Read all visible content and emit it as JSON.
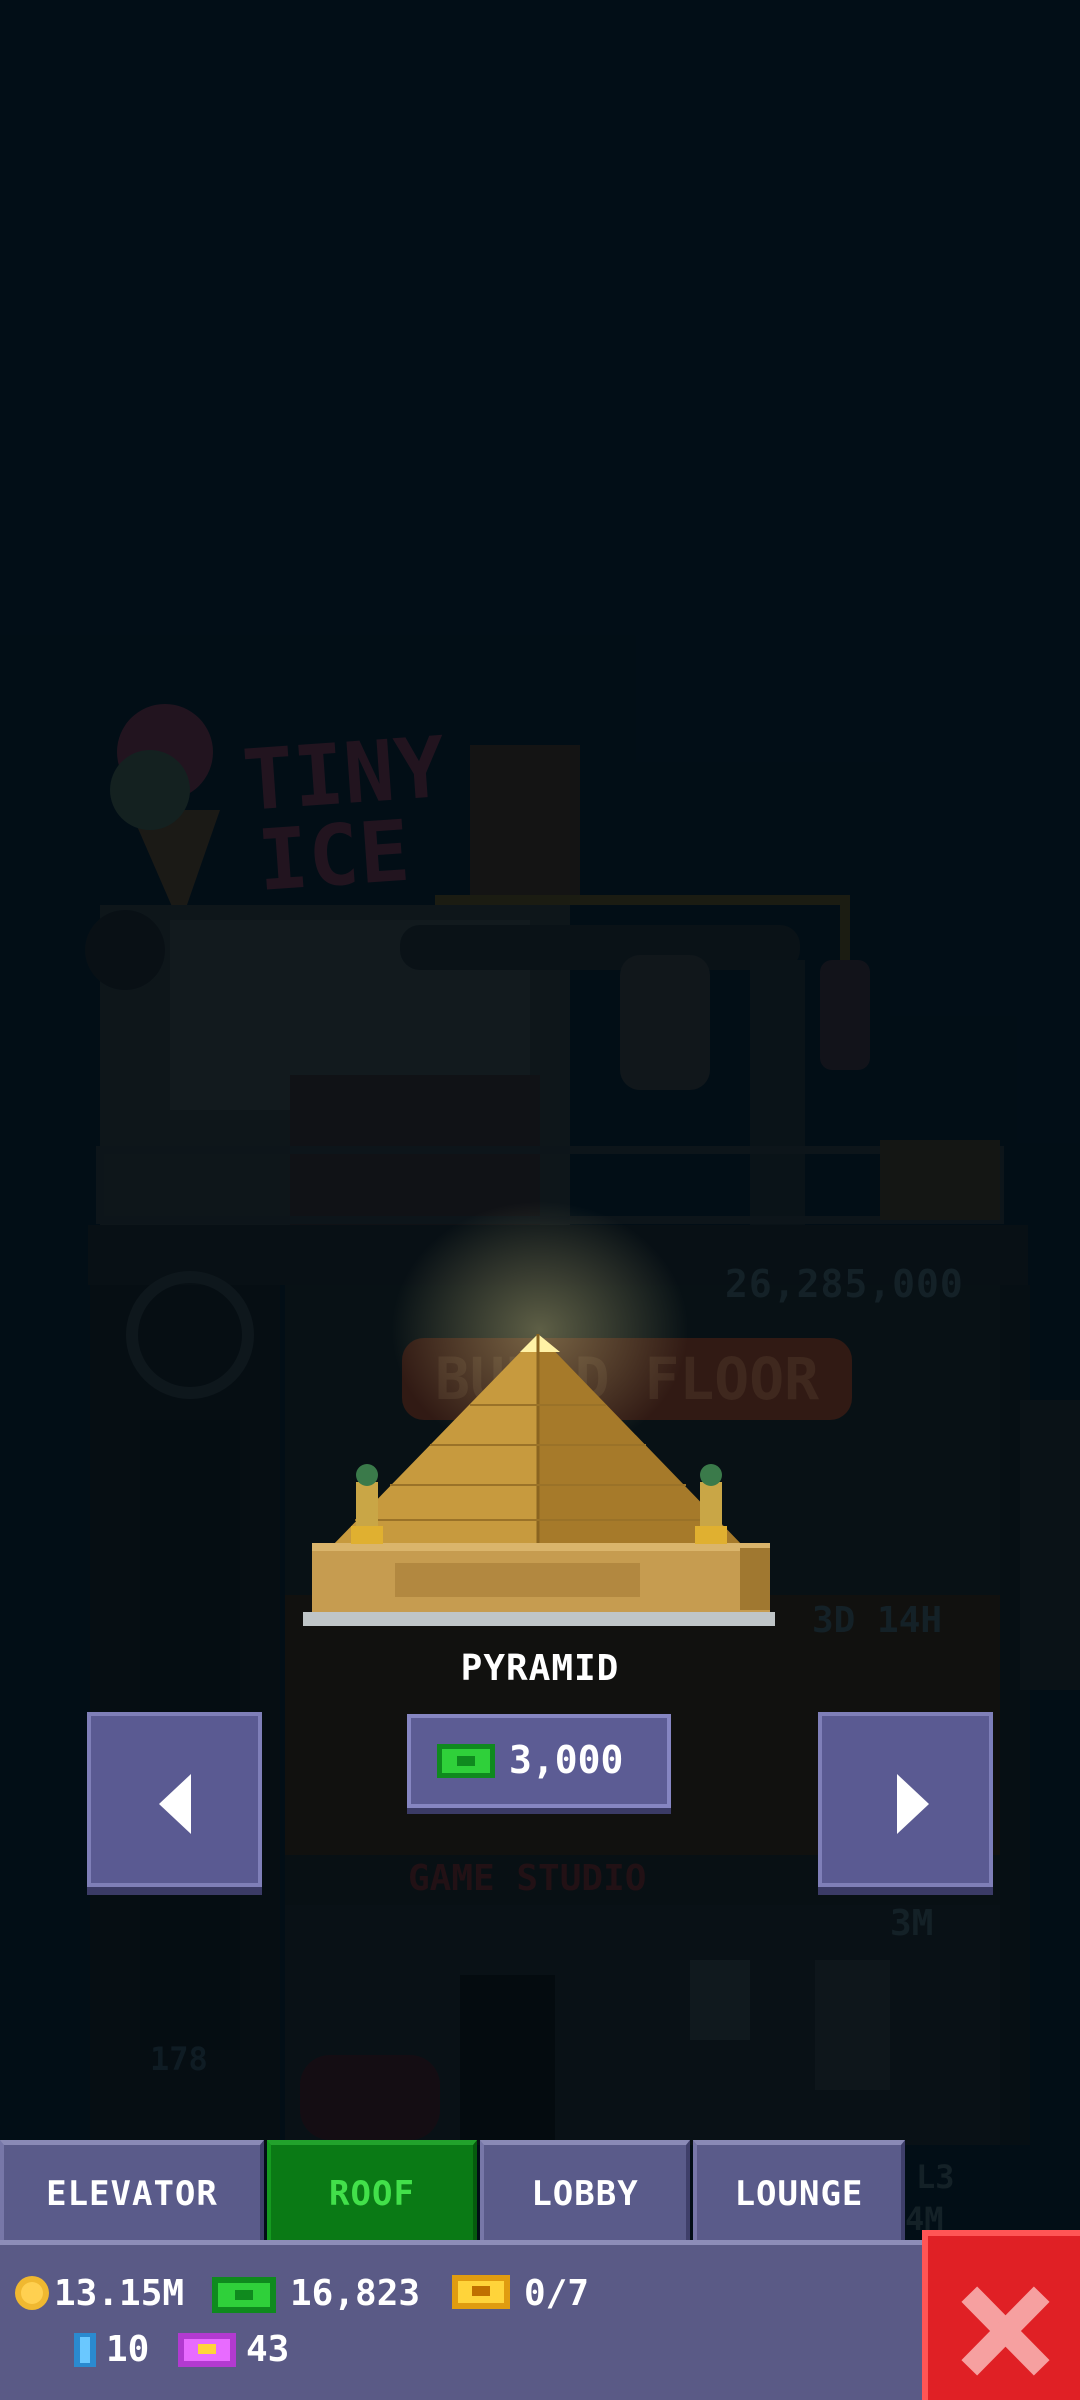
{
  "background": {
    "floor_price": "26,285,000",
    "build_floor_label": "BUILD FLOOR",
    "timer": "3D 14H",
    "studio_name": "GAME STUDIO",
    "studio_price": "3M",
    "floor_number": "178",
    "side_level": "L3",
    "side_value": "4M",
    "sign_text": "TINY ICE"
  },
  "preview": {
    "item_name": "PYRAMID",
    "price": "3,000",
    "price_icon": "bux-icon"
  },
  "nav": {
    "prev_icon": "left-arrow-icon",
    "next_icon": "right-arrow-icon"
  },
  "tabs": [
    {
      "label": "ELEVATOR",
      "active": false
    },
    {
      "label": "ROOF",
      "active": true
    },
    {
      "label": "LOBBY",
      "active": false
    },
    {
      "label": "LOUNGE",
      "active": false
    }
  ],
  "stats": {
    "coins": "13.15M",
    "bux": "16,823",
    "tickets": "0/7",
    "gems": "10",
    "vip": "43"
  },
  "colors": {
    "tab_active": "#0a7a15",
    "tab_inactive": "#5a5b8a",
    "close": "#e02025",
    "background": "#03101a"
  },
  "close_icon": "close-x-icon"
}
